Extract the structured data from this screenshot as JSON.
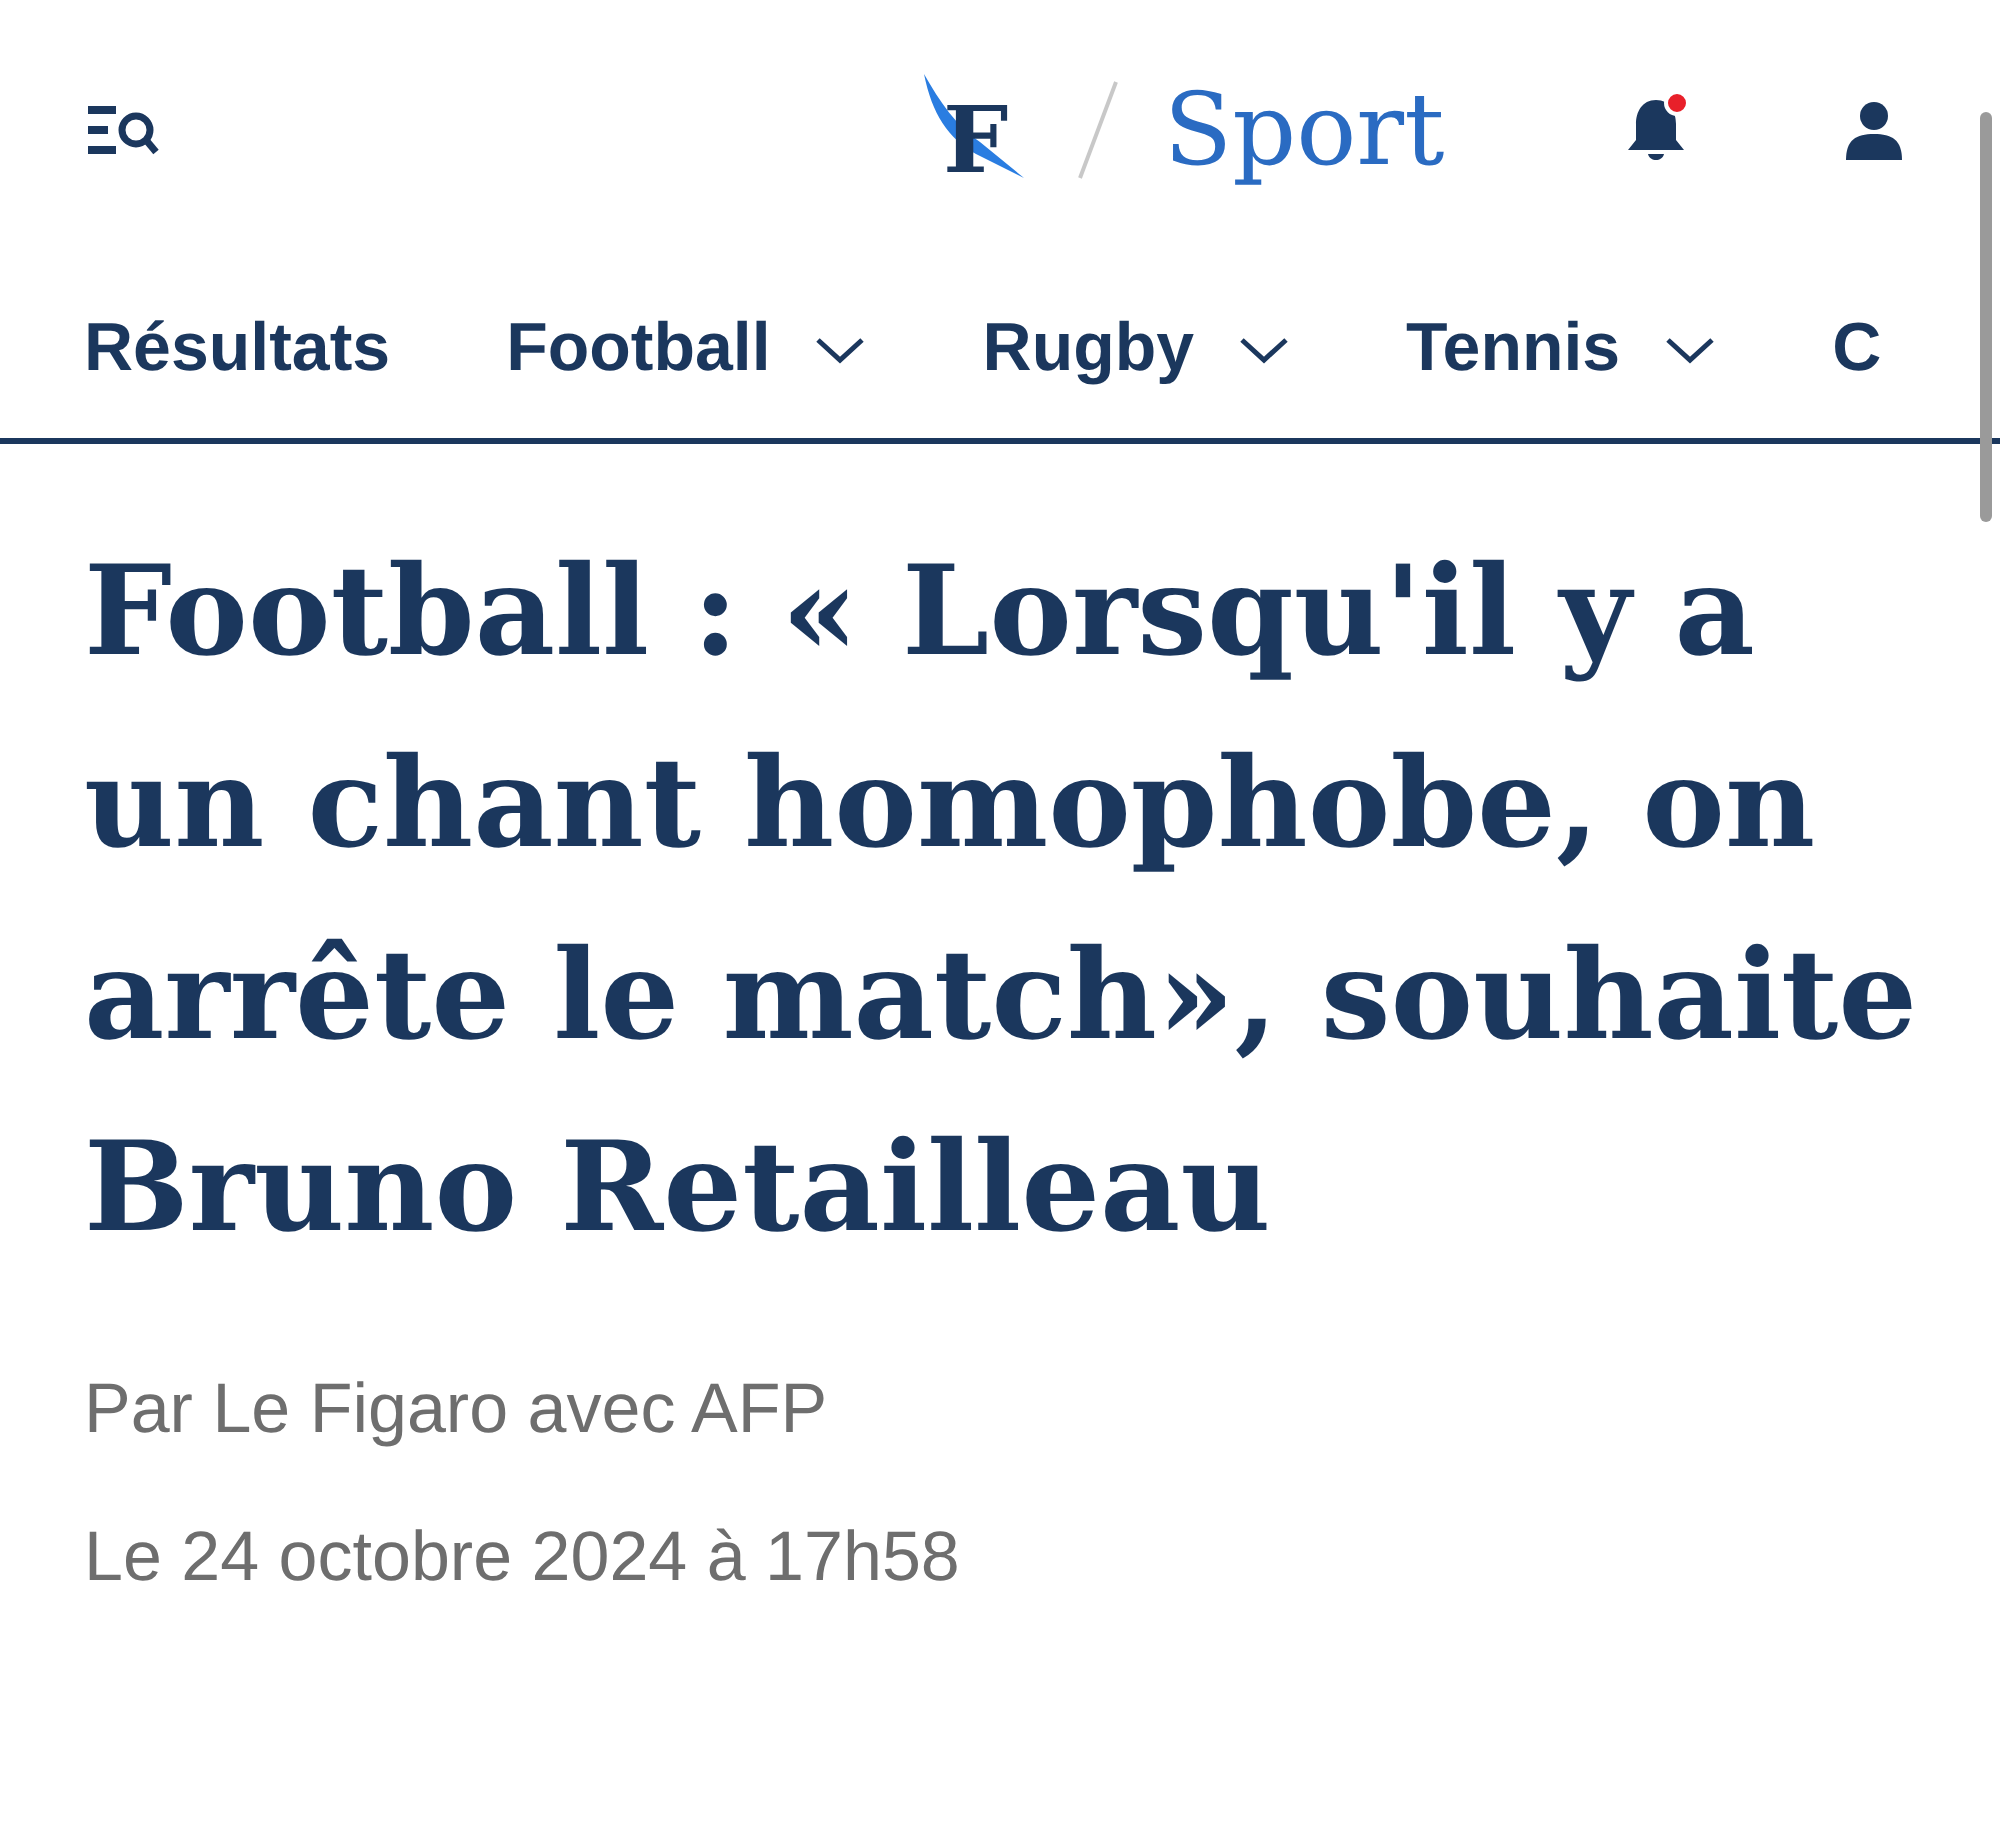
{
  "header": {
    "logo_letter": "F",
    "section": "Sport",
    "notifications_unread": true
  },
  "nav": [
    {
      "label": "Résultats",
      "has_dropdown": false
    },
    {
      "label": "Football",
      "has_dropdown": true
    },
    {
      "label": "Rugby",
      "has_dropdown": true
    },
    {
      "label": "Tennis",
      "has_dropdown": true
    },
    {
      "label": "C",
      "has_dropdown": false
    }
  ],
  "article": {
    "headline": "Football : « Lorsqu'il y a un chant homophobe, on arrête le match», souhaite Bruno Retailleau",
    "byline": "Par Le Figaro avec AFP",
    "date": "Le 24 octobre 2024 à 17h58"
  }
}
